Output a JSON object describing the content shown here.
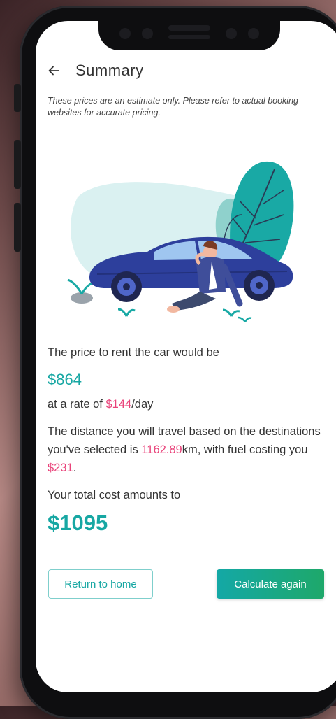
{
  "header": {
    "title": "Summary"
  },
  "disclaimer": "These prices are an estimate only. Please refer to actual booking websites for accurate pricing.",
  "rental": {
    "intro": "The price to rent the car would be",
    "price": "$864",
    "rate_prefix": "at a rate of ",
    "rate_value": "$144",
    "rate_suffix": "/day"
  },
  "distance": {
    "prefix": "The distance you will travel based on the destinations you've selected is ",
    "km_value": "1162.89",
    "km_unit": "km,",
    "fuel_prefix": " with fuel costing you ",
    "fuel_value": "$231",
    "fuel_suffix": "."
  },
  "total": {
    "label": "Your total cost amounts to",
    "value": "$1095"
  },
  "buttons": {
    "home": "Return to home",
    "again": "Calculate again"
  },
  "colors": {
    "accent": "#17a7a3",
    "highlight": "#e9437a",
    "button_gradient_start": "#14a8a6",
    "button_gradient_end": "#1ea86a"
  },
  "icons": {
    "back": "back-arrow-icon",
    "illustration": "car-breakdown-illustration"
  }
}
